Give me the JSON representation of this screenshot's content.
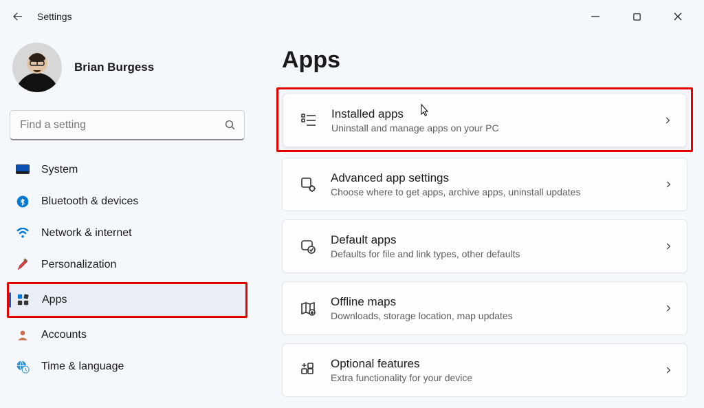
{
  "window": {
    "title": "Settings"
  },
  "user": {
    "name": "Brian Burgess"
  },
  "search": {
    "placeholder": "Find a setting"
  },
  "sidebar": {
    "items": [
      {
        "label": "System"
      },
      {
        "label": "Bluetooth & devices"
      },
      {
        "label": "Network & internet"
      },
      {
        "label": "Personalization"
      },
      {
        "label": "Apps"
      },
      {
        "label": "Accounts"
      },
      {
        "label": "Time & language"
      }
    ]
  },
  "main": {
    "heading": "Apps",
    "cards": [
      {
        "title": "Installed apps",
        "desc": "Uninstall and manage apps on your PC"
      },
      {
        "title": "Advanced app settings",
        "desc": "Choose where to get apps, archive apps, uninstall updates"
      },
      {
        "title": "Default apps",
        "desc": "Defaults for file and link types, other defaults"
      },
      {
        "title": "Offline maps",
        "desc": "Downloads, storage location, map updates"
      },
      {
        "title": "Optional features",
        "desc": "Extra functionality for your device"
      }
    ]
  }
}
